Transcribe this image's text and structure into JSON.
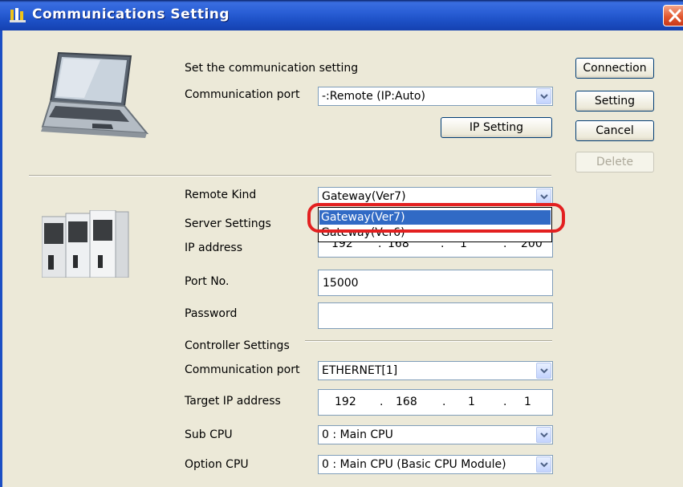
{
  "window": {
    "title": "Communications Setting"
  },
  "top_section": {
    "heading": "Set the communication setting",
    "comm_port_label": "Communication port",
    "comm_port_value": "-:Remote  (IP:Auto)",
    "ip_setting_button": "IP Setting"
  },
  "buttons": {
    "connection": "Connection",
    "setting": "Setting",
    "cancel": "Cancel",
    "delete": "Delete"
  },
  "remote": {
    "remote_kind_label": "Remote Kind",
    "remote_kind_value": "Gateway(Ver7)",
    "dropdown_options": [
      "Gateway(Ver7)",
      "Gateway(Ver6)"
    ],
    "server_settings_label": "Server Settings",
    "ip_address_label": "IP address",
    "ip_address": [
      "192",
      "168",
      "1",
      "200"
    ],
    "port_label": "Port No.",
    "port_value": "15000",
    "password_label": "Password",
    "password_value": ""
  },
  "controller": {
    "heading": "Controller Settings",
    "comm_port_label": "Communication port",
    "comm_port_value": "ETHERNET[1]",
    "target_ip_label": "Target IP address",
    "target_ip": [
      "192",
      "168",
      "1",
      "1"
    ],
    "sub_cpu_label": "Sub CPU",
    "sub_cpu_value": "0 : Main CPU",
    "option_cpu_label": "Option CPU",
    "option_cpu_value": "0 : Main CPU (Basic CPU Module)"
  },
  "ip_dot": ".",
  "colors": {
    "highlight": "#e32020",
    "selection": "#316ac5",
    "titlebar": "#1c4fc4"
  }
}
